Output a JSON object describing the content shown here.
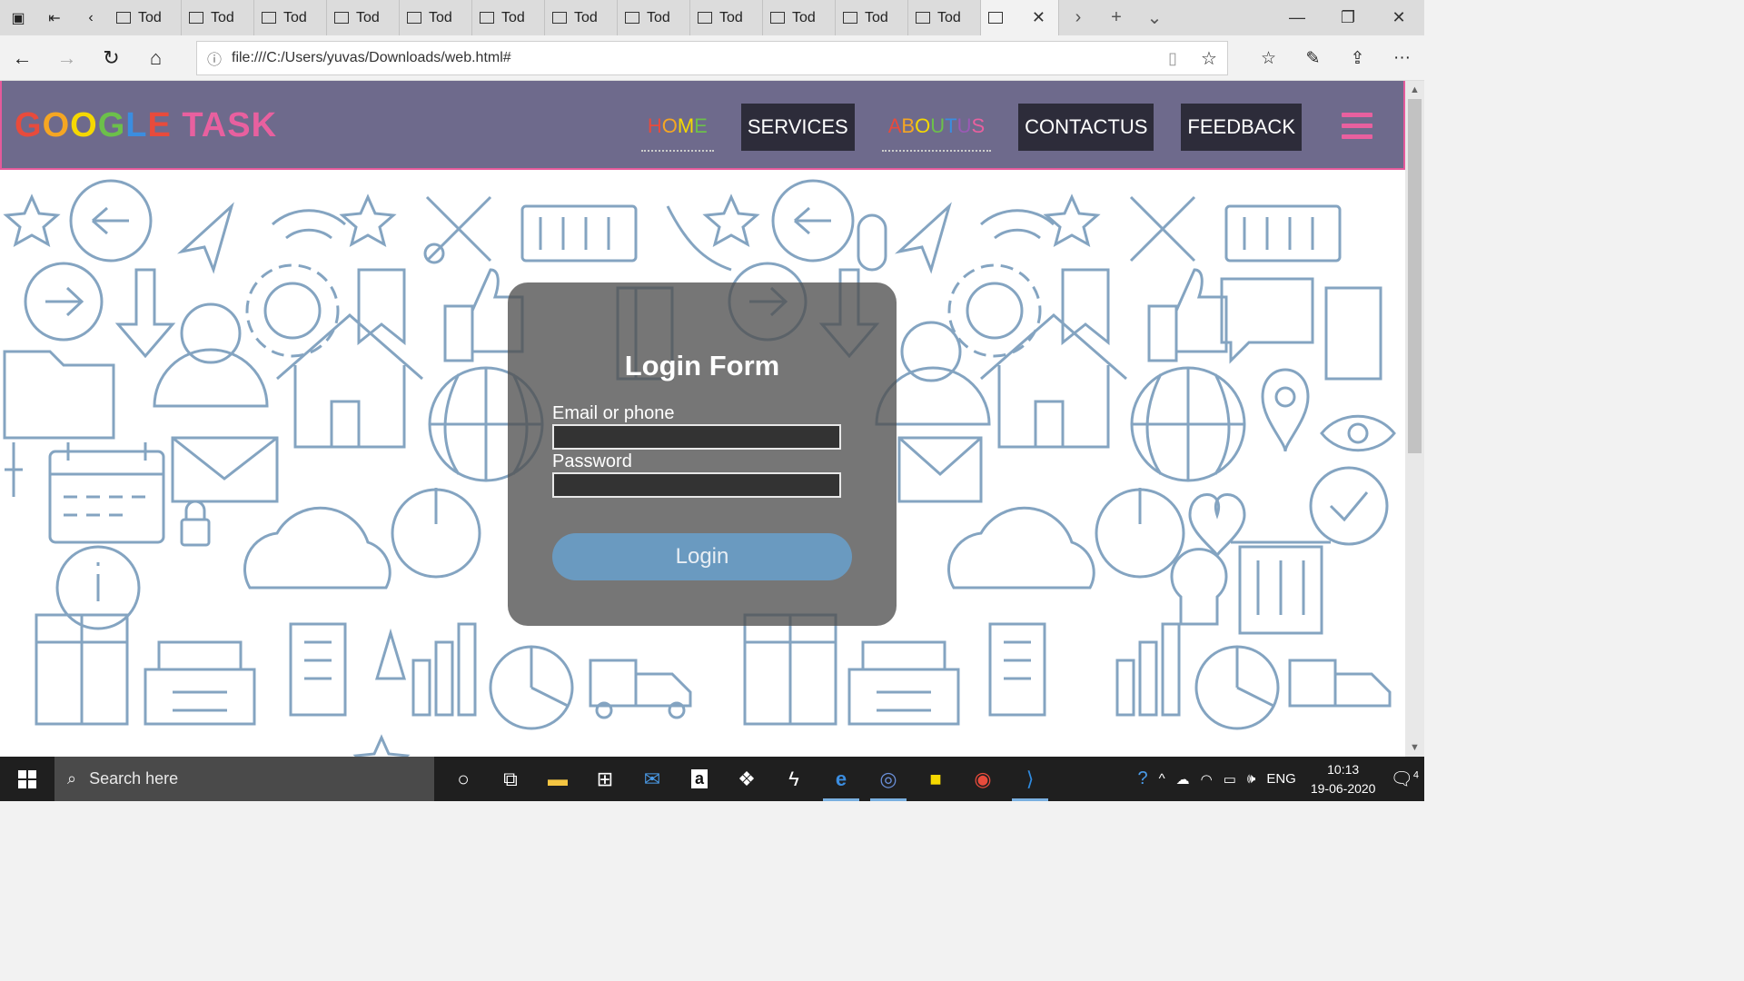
{
  "browser": {
    "tabs": [
      {
        "label": "Tod"
      },
      {
        "label": "Tod"
      },
      {
        "label": "Tod"
      },
      {
        "label": "Tod"
      },
      {
        "label": "Tod"
      },
      {
        "label": "Tod"
      },
      {
        "label": "Tod"
      },
      {
        "label": "Tod"
      },
      {
        "label": "Tod"
      },
      {
        "label": "Tod"
      },
      {
        "label": "Tod"
      },
      {
        "label": "Tod"
      }
    ],
    "url": "file:///C:/Users/yuvas/Downloads/web.html#"
  },
  "site": {
    "logo": "GOOGLE TASK",
    "menu": {
      "home": "HOME",
      "services": "SERVICES",
      "aboutus": "ABOUTUS",
      "contactus": "CONTACTUS",
      "feedback": "FEEDBACK"
    },
    "accent": "#e8609f",
    "navbar_bg": "#6e6a8c"
  },
  "login": {
    "title": "Login Form",
    "email_label": "Email or phone",
    "password_label": "Password",
    "button": "Login"
  },
  "taskbar": {
    "search_placeholder": "Search here",
    "language": "ENG",
    "time": "10:13",
    "date": "19-06-2020",
    "notification_count": "4"
  }
}
